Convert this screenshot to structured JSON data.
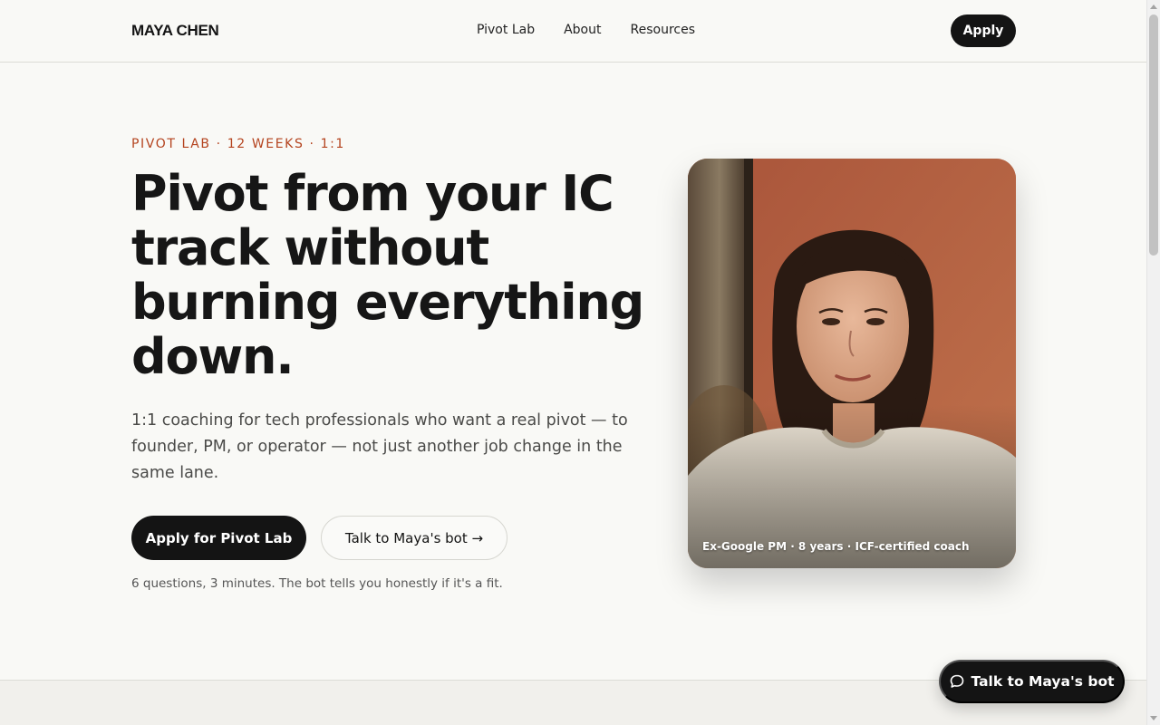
{
  "header": {
    "brand": "MAYA CHEN",
    "nav": [
      "Pivot Lab",
      "About",
      "Resources"
    ],
    "apply_label": "Apply"
  },
  "hero": {
    "eyebrow": "PIVOT LAB · 12 WEEKS · 1:1",
    "headline_lines": [
      "Pivot from your IC",
      "track without",
      "burning everything",
      "down."
    ],
    "lede": "1:1 coaching for tech professionals who want a real pivot — to founder, PM, or operator — not just another job change in the same lane.",
    "primary_cta": "Apply for Pivot Lab",
    "secondary_cta": "Talk to Maya's bot →",
    "note": "6 questions, 3 minutes. The bot tells you honestly if it's a fit.",
    "photo_caption": "Ex-Google PM · 8 years · ICF-certified coach"
  },
  "chat_widget": {
    "label": "Talk to Maya's bot",
    "icon": "chat-bubble-icon"
  },
  "colors": {
    "background": "#f9f9f6",
    "ink": "#141414",
    "accent": "#b4431e"
  }
}
